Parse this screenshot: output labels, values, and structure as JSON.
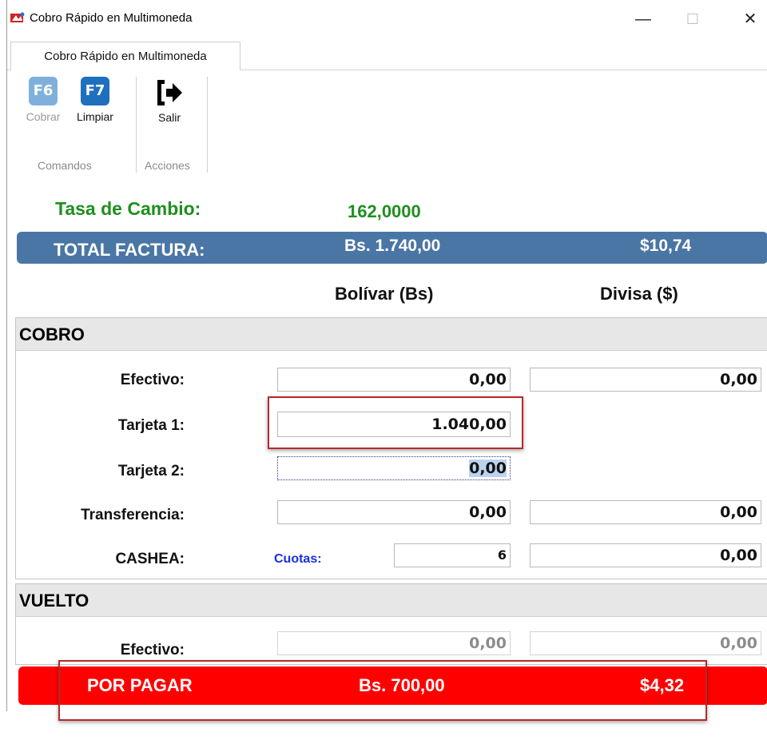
{
  "window": {
    "title": "Cobro Rápido en Multimoneda",
    "minimize_glyph": "—",
    "maximize_glyph": "☐",
    "close_glyph": "✕"
  },
  "ribbon": {
    "tab_label": "Cobro Rápido en Multimoneda",
    "buttons": {
      "cobrar": {
        "key": "F6",
        "label": "Cobrar",
        "enabled": false
      },
      "limpiar": {
        "key": "F7",
        "label": "Limpiar",
        "enabled": true
      },
      "salir": {
        "label": "Salir",
        "icon": "exit-arrow-icon"
      }
    },
    "groups": {
      "comandos": "Comandos",
      "acciones": "Acciones"
    }
  },
  "exchange": {
    "label": "Tasa de Cambio:",
    "value": "162,0000"
  },
  "total": {
    "label": "TOTAL FACTURA:",
    "bs": "Bs. 1.740,00",
    "usd": "$10,74"
  },
  "columns": {
    "bolivar": "Bolívar (Bs)",
    "divisa": "Divisa ($)"
  },
  "cobro": {
    "title": "COBRO",
    "efectivo": {
      "label": "Efectivo:",
      "bs": "0,00",
      "usd": "0,00"
    },
    "tarjeta1": {
      "label": "Tarjeta 1:",
      "bs": "1.040,00"
    },
    "tarjeta2": {
      "label": "Tarjeta 2:",
      "bs": "0,00"
    },
    "transferencia": {
      "label": "Transferencia:",
      "bs": "0,00",
      "usd": "0,00"
    },
    "cashea": {
      "label": "CASHEA:",
      "cuotas_label": "Cuotas:",
      "cuotas": "6",
      "usd": "0,00"
    }
  },
  "vuelto": {
    "title": "VUELTO",
    "efectivo": {
      "label": "Efectivo:",
      "bs": "0,00",
      "usd": "0,00"
    }
  },
  "por_pagar": {
    "label": "POR PAGAR",
    "bs": "Bs. 700,00",
    "usd": "$4,32"
  },
  "colors": {
    "accent_green": "#1e8f1e",
    "total_bar": "#4a76a5",
    "por_pagar_bar": "#ff0000",
    "fkey_disabled": "#7fb0dc",
    "fkey_enabled": "#1f6fbf"
  }
}
